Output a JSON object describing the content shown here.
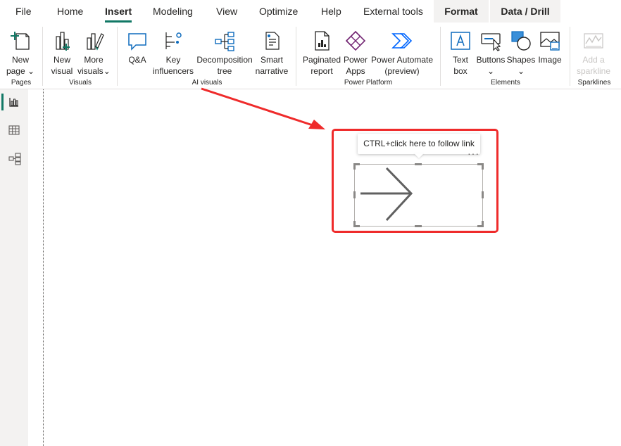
{
  "menu": {
    "tabs": [
      "File",
      "Home",
      "Insert",
      "Modeling",
      "View",
      "Optimize",
      "Help",
      "External tools",
      "Format",
      "Data / Drill"
    ],
    "active": "Insert"
  },
  "ribbon": {
    "pages": {
      "group": "Pages",
      "new_page": [
        "New",
        "page"
      ]
    },
    "visuals": {
      "group": "Visuals",
      "new_visual": [
        "New",
        "visual"
      ],
      "more_visuals": [
        "More",
        "visuals"
      ]
    },
    "ai": {
      "group": "AI visuals",
      "qa": "Q&A",
      "key_influencers": [
        "Key",
        "influencers"
      ],
      "decomposition": [
        "Decomposition",
        "tree"
      ],
      "smart_narrative": [
        "Smart",
        "narrative"
      ]
    },
    "platform": {
      "group": "Power Platform",
      "paginated": [
        "Paginated",
        "report"
      ],
      "power_apps": [
        "Power",
        "Apps"
      ],
      "power_automate": [
        "Power Automate",
        "(preview)"
      ]
    },
    "elements": {
      "group": "Elements",
      "text_box": [
        "Text",
        "box"
      ],
      "buttons": "Buttons",
      "shapes": "Shapes",
      "image": "Image"
    },
    "sparklines": {
      "group": "Sparklines",
      "add_sparkline": [
        "Add a",
        "sparkline"
      ]
    }
  },
  "canvas": {
    "tooltip": "CTRL+click here to follow link"
  },
  "colors": {
    "accent": "#117865",
    "highlight": "#ef2b2b",
    "arrow": "#606060",
    "powerapps": "#742774",
    "automate": "#0066ff"
  }
}
